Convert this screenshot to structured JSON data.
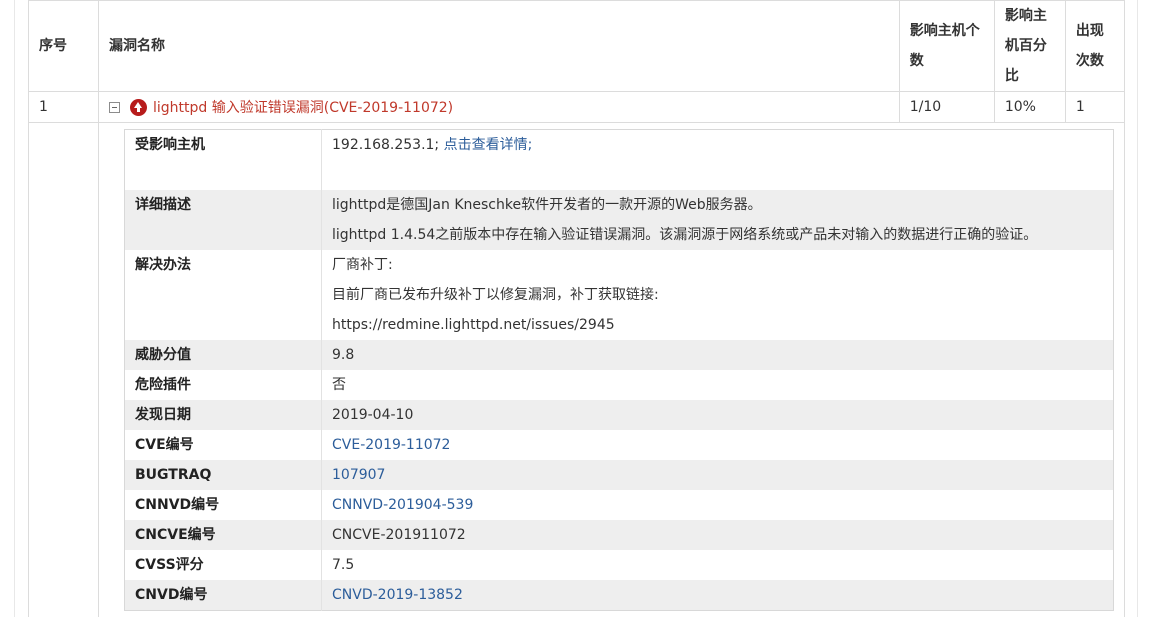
{
  "table": {
    "headers": {
      "index": "序号",
      "name": "漏洞名称",
      "hosts_count": [
        "影响主机个",
        "数"
      ],
      "hosts_percent": [
        "影响主",
        "机百分",
        "比"
      ],
      "occurrences": [
        "出现",
        "次数"
      ]
    },
    "row": {
      "index": "1",
      "name": "lighttpd 输入验证错误漏洞(CVE-2019-11072)",
      "hosts_count": "1/10",
      "hosts_percent": "10%",
      "occurrences": "1"
    }
  },
  "detail": {
    "affected_hosts": {
      "label": "受影响主机",
      "value": "192.168.253.1;",
      "link": "点击查看详情;"
    },
    "description": {
      "label": "详细描述",
      "lines": [
        "lighttpd是德国Jan Kneschke软件开发者的一款开源的Web服务器。",
        "lighttpd 1.4.54之前版本中存在输入验证错误漏洞。该漏洞源于网络系统或产品未对输入的数据进行正确的验证。"
      ]
    },
    "solution": {
      "label": "解决办法",
      "lines": [
        "厂商补丁:",
        "目前厂商已发布升级补丁以修复漏洞，补丁获取链接:",
        "https://redmine.lighttpd.net/issues/2945"
      ]
    },
    "threat_score": {
      "label": "威胁分值",
      "value": "9.8"
    },
    "dangerous_plugin": {
      "label": "危险插件",
      "value": "否"
    },
    "discovered": {
      "label": "发现日期",
      "value": "2019-04-10"
    },
    "cve": {
      "label": "CVE编号",
      "value": "CVE-2019-11072"
    },
    "bugtraq": {
      "label": "BUGTRAQ",
      "value": "107907"
    },
    "cnnvd": {
      "label": "CNNVD编号",
      "value": "CNNVD-201904-539"
    },
    "cncve": {
      "label": "CNCVE编号",
      "value": "CNCVE-201911072"
    },
    "cvss": {
      "label": "CVSS评分",
      "value": "7.5"
    },
    "cnvd": {
      "label": "CNVD编号",
      "value": "CNVD-2019-13852"
    }
  },
  "colors": {
    "vuln_name": "#c0392b",
    "link": "#2c5d9a",
    "risk_icon": "#b71c1c",
    "row_alt": "#eeeeee"
  },
  "icons": {
    "toggle": "collapse-minus-icon",
    "risk": "high-risk-arrow-up-icon"
  }
}
